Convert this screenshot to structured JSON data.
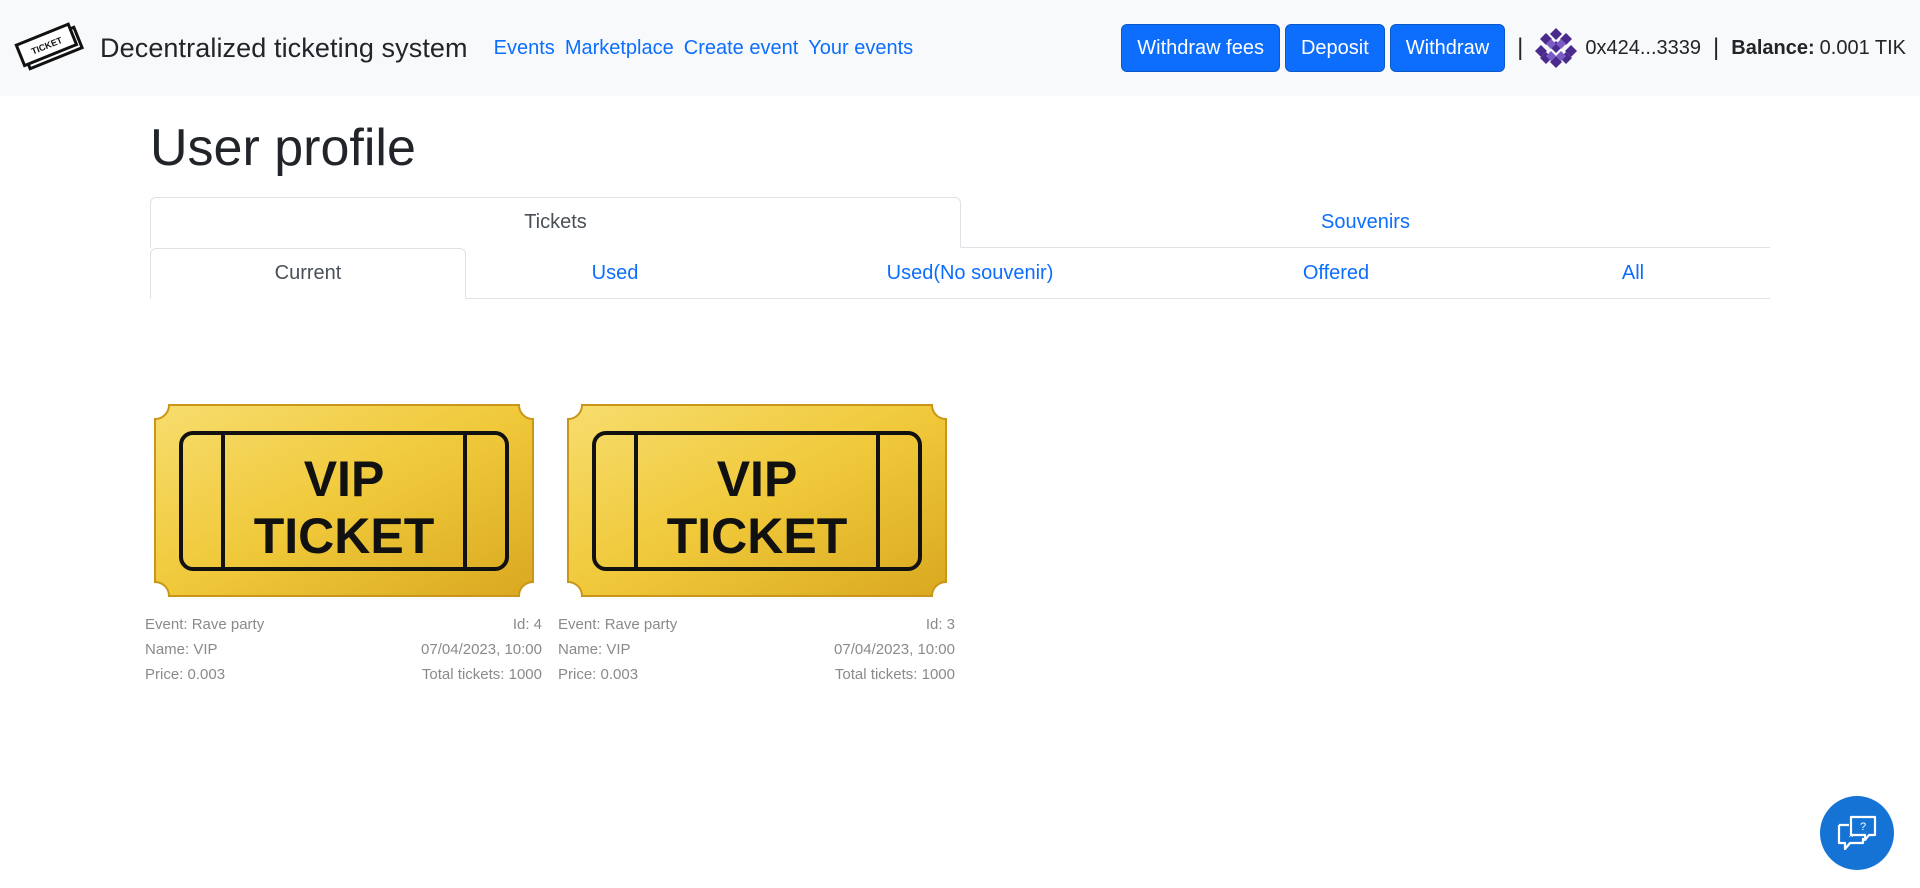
{
  "navbar": {
    "brand": "Decentralized ticketing system",
    "logo_text": "TICKET",
    "links": [
      {
        "label": "Events"
      },
      {
        "label": "Marketplace"
      },
      {
        "label": "Create event"
      },
      {
        "label": "Your events"
      }
    ],
    "buttons": {
      "withdraw_fees": "Withdraw fees",
      "deposit": "Deposit",
      "withdraw": "Withdraw"
    },
    "separator": "|",
    "address": "0x424...3339",
    "balance_label": "Balance:",
    "balance_value": "0.001 TIK"
  },
  "page": {
    "title": "User profile"
  },
  "tabs_main": [
    {
      "label": "Tickets",
      "active": true
    },
    {
      "label": "Souvenirs",
      "active": false
    }
  ],
  "tabs_sub": [
    {
      "label": "Current",
      "active": true
    },
    {
      "label": "Used",
      "active": false
    },
    {
      "label": "Used(No souvenir)",
      "active": false
    },
    {
      "label": "Offered",
      "active": false
    },
    {
      "label": "All",
      "active": false
    }
  ],
  "tickets": [
    {
      "image_text": [
        "VIP",
        "TICKET"
      ],
      "event": "Event: Rave party",
      "id": "Id: 4",
      "name": "Name: VIP",
      "date": "07/04/2023, 10:00",
      "price": "Price: 0.003",
      "total": "Total tickets: 1000"
    },
    {
      "image_text": [
        "VIP",
        "TICKET"
      ],
      "event": "Event: Rave party",
      "id": "Id: 3",
      "name": "Name: VIP",
      "date": "07/04/2023, 10:00",
      "price": "Price: 0.003",
      "total": "Total tickets: 1000"
    }
  ],
  "icons": {
    "logo": "ticket-logo-icon",
    "avatar": "identicon-avatar",
    "help": "chat-help-icon"
  },
  "colors": {
    "accent": "#0d6efd",
    "navbar_bg": "#f8f9fa",
    "ticket_gold": "#f2cf4a",
    "help_button": "#1673d6"
  }
}
